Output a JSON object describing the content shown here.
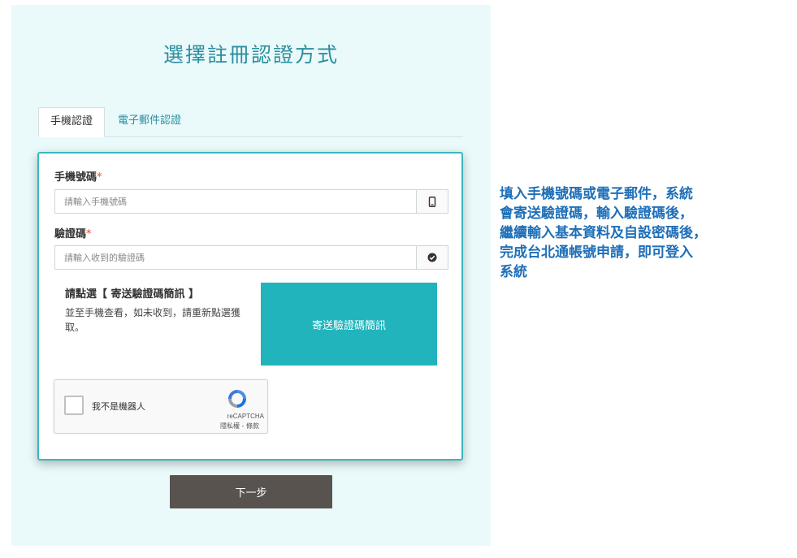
{
  "page_title": "選擇註冊認證方式",
  "tabs": [
    {
      "label": "手機認證",
      "active": true
    },
    {
      "label": "電子郵件認證",
      "active": false
    }
  ],
  "form": {
    "phone": {
      "label": "手機號碼",
      "required_mark": "*",
      "placeholder": "請輸入手機號碼",
      "value": "",
      "addon_icon": "mobile-phone-icon"
    },
    "code": {
      "label": "驗證碼",
      "required_mark": "*",
      "placeholder": "請輸入收到的驗證碼",
      "value": "",
      "addon_icon": "check-circle-icon"
    },
    "instructions": {
      "title": "請點選【 寄送驗證碼簡訊 】",
      "text": "並至手機查看，如未收到，請重新點選獲取。"
    },
    "send_sms_button": "寄送驗證碼簡訊",
    "recaptcha": {
      "label": "我不是機器人",
      "brand": "reCAPTCHA",
      "links": "隱私權 - 條款"
    }
  },
  "next_button": "下一步",
  "annotation": {
    "lines": [
      "填入手機號碼或電子郵件，系統",
      "會寄送驗證碼，輸入驗證碼後，",
      "繼續輸入基本資料及自設密碼後，",
      "完成台北通帳號申請，即可登入",
      "系統"
    ]
  },
  "colors": {
    "panel_bg": "#eafafa",
    "accent": "#21b4bc",
    "title": "#2b8ea0",
    "required": "#e24a3a",
    "next_button": "#595350",
    "annotation": "#1e6fb8"
  }
}
